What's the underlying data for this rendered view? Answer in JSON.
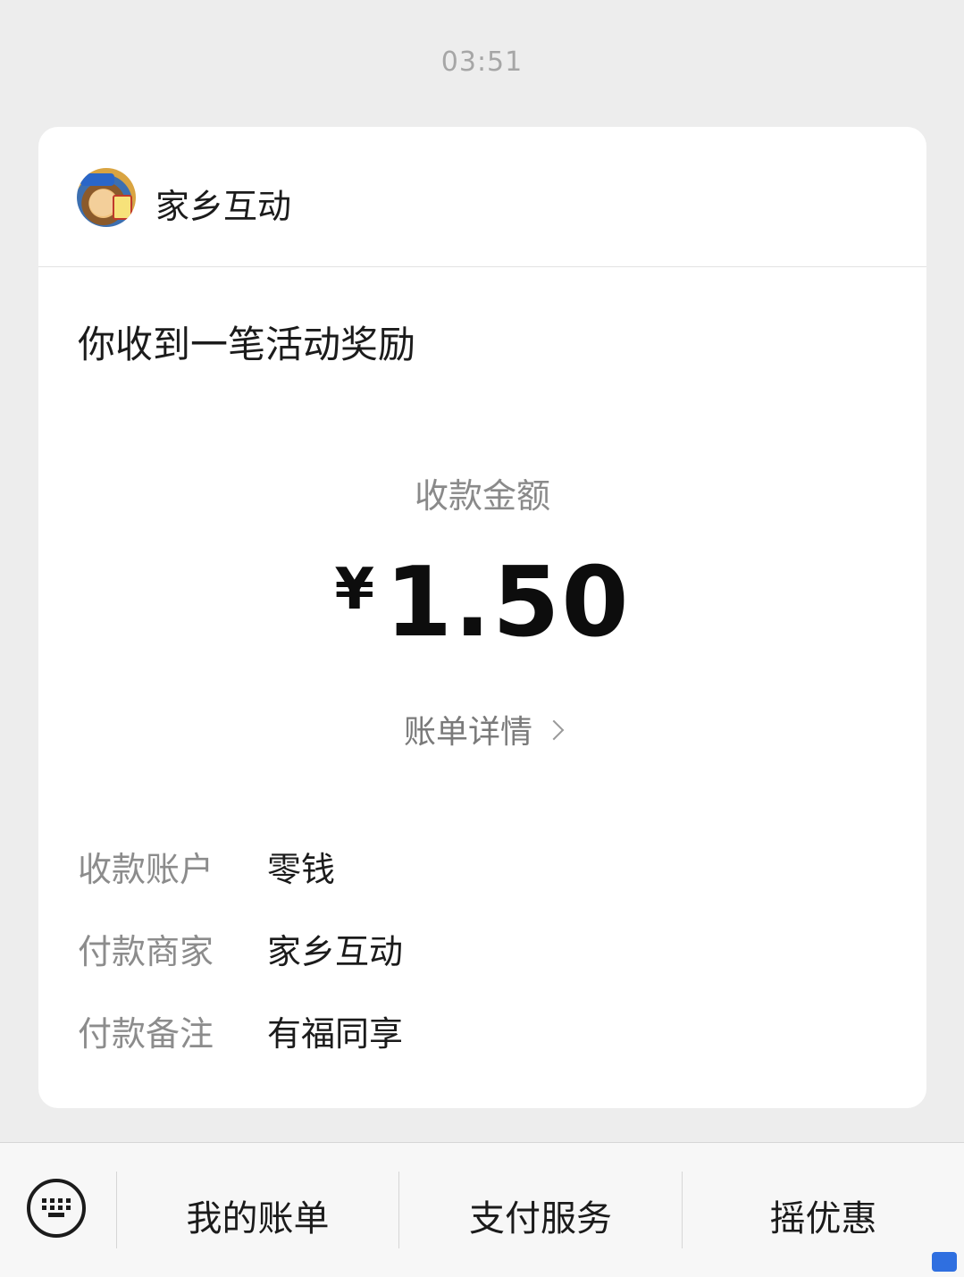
{
  "timestamp": "03:51",
  "card": {
    "merchant_name": "家乡互动",
    "title": "你收到一笔活动奖励",
    "amount_label": "收款金额",
    "currency_symbol": "¥",
    "amount": "1.50",
    "bill_detail_label": "账单详情",
    "info_rows": [
      {
        "key": "收款账户",
        "value": "零钱"
      },
      {
        "key": "付款商家",
        "value": "家乡互动"
      },
      {
        "key": "付款备注",
        "value": "有福同享"
      }
    ]
  },
  "bottom_menu": {
    "keyboard_icon": "keyboard-icon",
    "items": [
      {
        "label": "我的账单"
      },
      {
        "label": "支付服务"
      },
      {
        "label": "摇优惠"
      }
    ]
  },
  "colors": {
    "background": "#ededed",
    "card": "#ffffff",
    "muted_text": "#8c8c8c"
  }
}
